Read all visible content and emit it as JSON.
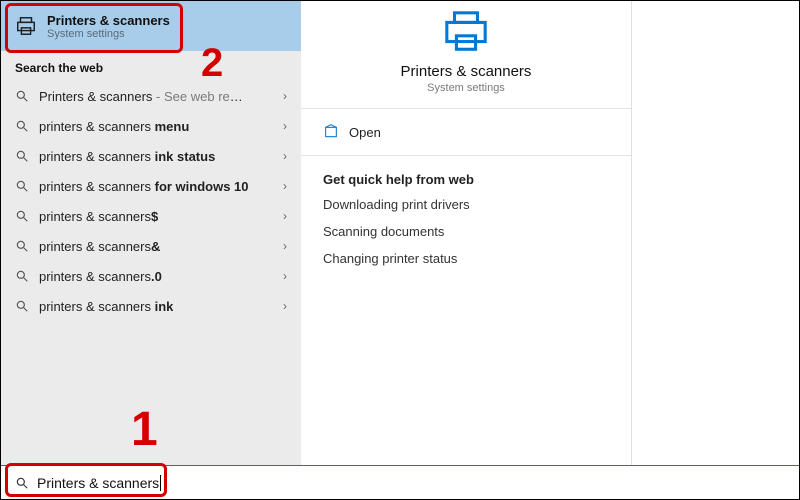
{
  "best_match": {
    "title": "Printers & scanners",
    "subtitle": "System settings"
  },
  "web_label": "Search the web",
  "web_results": [
    {
      "prefix": "Printers & scanners",
      "bold_suffix": "",
      "gray_suffix": " - See web results"
    },
    {
      "prefix": "printers & scanners ",
      "bold_suffix": "menu",
      "gray_suffix": ""
    },
    {
      "prefix": "printers & scanners ",
      "bold_suffix": "ink status",
      "gray_suffix": ""
    },
    {
      "prefix": "printers & scanners ",
      "bold_suffix": "for windows 10",
      "gray_suffix": ""
    },
    {
      "prefix": "printers & scanners",
      "bold_suffix": "$",
      "gray_suffix": ""
    },
    {
      "prefix": "printers & scanners",
      "bold_suffix": "&",
      "gray_suffix": ""
    },
    {
      "prefix": "printers & scanners",
      "bold_suffix": ".0",
      "gray_suffix": ""
    },
    {
      "prefix": "printers & scanners ",
      "bold_suffix": "ink",
      "gray_suffix": ""
    }
  ],
  "search_value": "Printers & scanners",
  "detail": {
    "title": "Printers & scanners",
    "subtitle": "System settings",
    "open": "Open",
    "qh_title": "Get quick help from web",
    "qh_links": [
      "Downloading print drivers",
      "Scanning documents",
      "Changing printer status"
    ]
  },
  "annot": {
    "n1": "1",
    "n2": "2"
  }
}
